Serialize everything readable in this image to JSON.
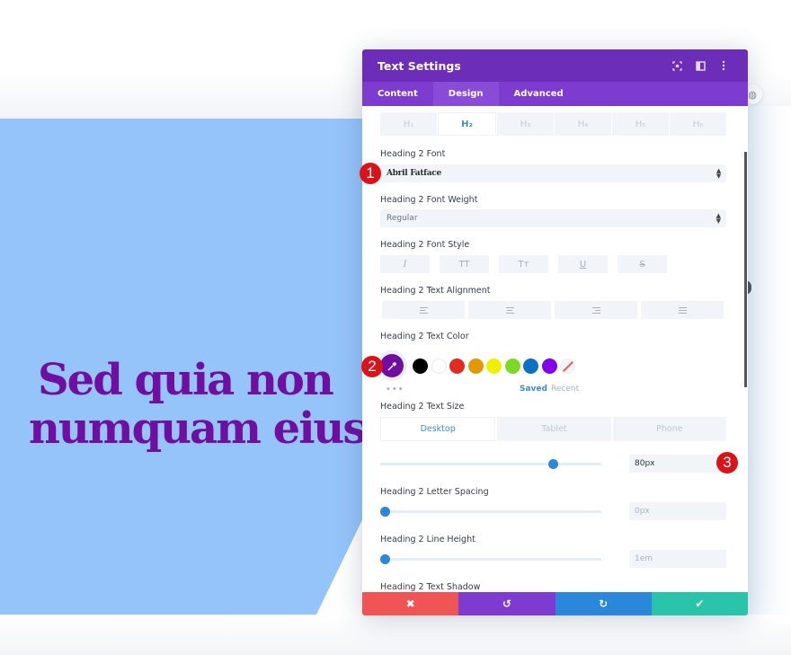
{
  "canvas": {
    "heading_lines": [
      "Sed quia non",
      "numquam eius"
    ],
    "heading_color": "#6f0ea1",
    "background_color": "#95c4fa"
  },
  "panel": {
    "title": "Text Settings",
    "header_icons": [
      "focus-icon",
      "split-view-icon",
      "more-options-icon"
    ],
    "tabs": [
      {
        "label": "Content",
        "active": false
      },
      {
        "label": "Design",
        "active": true
      },
      {
        "label": "Advanced",
        "active": false
      }
    ],
    "heading_levels": [
      {
        "label": "H₁",
        "active": false
      },
      {
        "label": "H₂",
        "active": true
      },
      {
        "label": "H₃",
        "active": false
      },
      {
        "label": "H₄",
        "active": false
      },
      {
        "label": "H₅",
        "active": false
      },
      {
        "label": "H₆",
        "active": false
      }
    ],
    "font": {
      "label": "Heading 2 Font",
      "value": "Abril Fatface"
    },
    "font_weight": {
      "label": "Heading 2 Font Weight",
      "value": "Regular"
    },
    "font_style": {
      "label": "Heading 2 Font Style",
      "buttons": [
        "I",
        "TT",
        "Tᴛ",
        "U",
        "S"
      ]
    },
    "alignment": {
      "label": "Heading 2 Text Alignment",
      "options": [
        "left",
        "center",
        "right",
        "justify"
      ]
    },
    "text_color": {
      "label": "Heading 2 Text Color",
      "selected": "#6f0ea1",
      "swatches": [
        "#000000",
        "#ffffff",
        "#e02b20",
        "#e09900",
        "#edf000",
        "#7cda24",
        "#0c71c3",
        "#8300e9",
        "none"
      ],
      "more_label": "•••",
      "saved_label": "Saved",
      "recent_label": "Recent"
    },
    "text_size": {
      "label": "Heading 2 Text Size",
      "devices": [
        {
          "label": "Desktop",
          "active": true
        },
        {
          "label": "Tablet",
          "active": false
        },
        {
          "label": "Phone",
          "active": false
        }
      ],
      "value": "80px",
      "slider_fraction": 0.78
    },
    "letter_spacing": {
      "label": "Heading 2 Letter Spacing",
      "value": "0px",
      "slider_fraction": 0.02
    },
    "line_height": {
      "label": "Heading 2 Line Height",
      "value": "1em",
      "slider_fraction": 0.02
    },
    "text_shadow": {
      "label": "Heading 2 Text Shadow"
    },
    "footer": [
      {
        "name": "cancel",
        "icon": "✖",
        "color": "#ef5555"
      },
      {
        "name": "undo",
        "icon": "↺",
        "color": "#7e3bd0"
      },
      {
        "name": "redo",
        "icon": "↻",
        "color": "#2b87da"
      },
      {
        "name": "save",
        "icon": "✔",
        "color": "#29c4a9"
      }
    ]
  },
  "markers": [
    "1",
    "2",
    "3"
  ]
}
